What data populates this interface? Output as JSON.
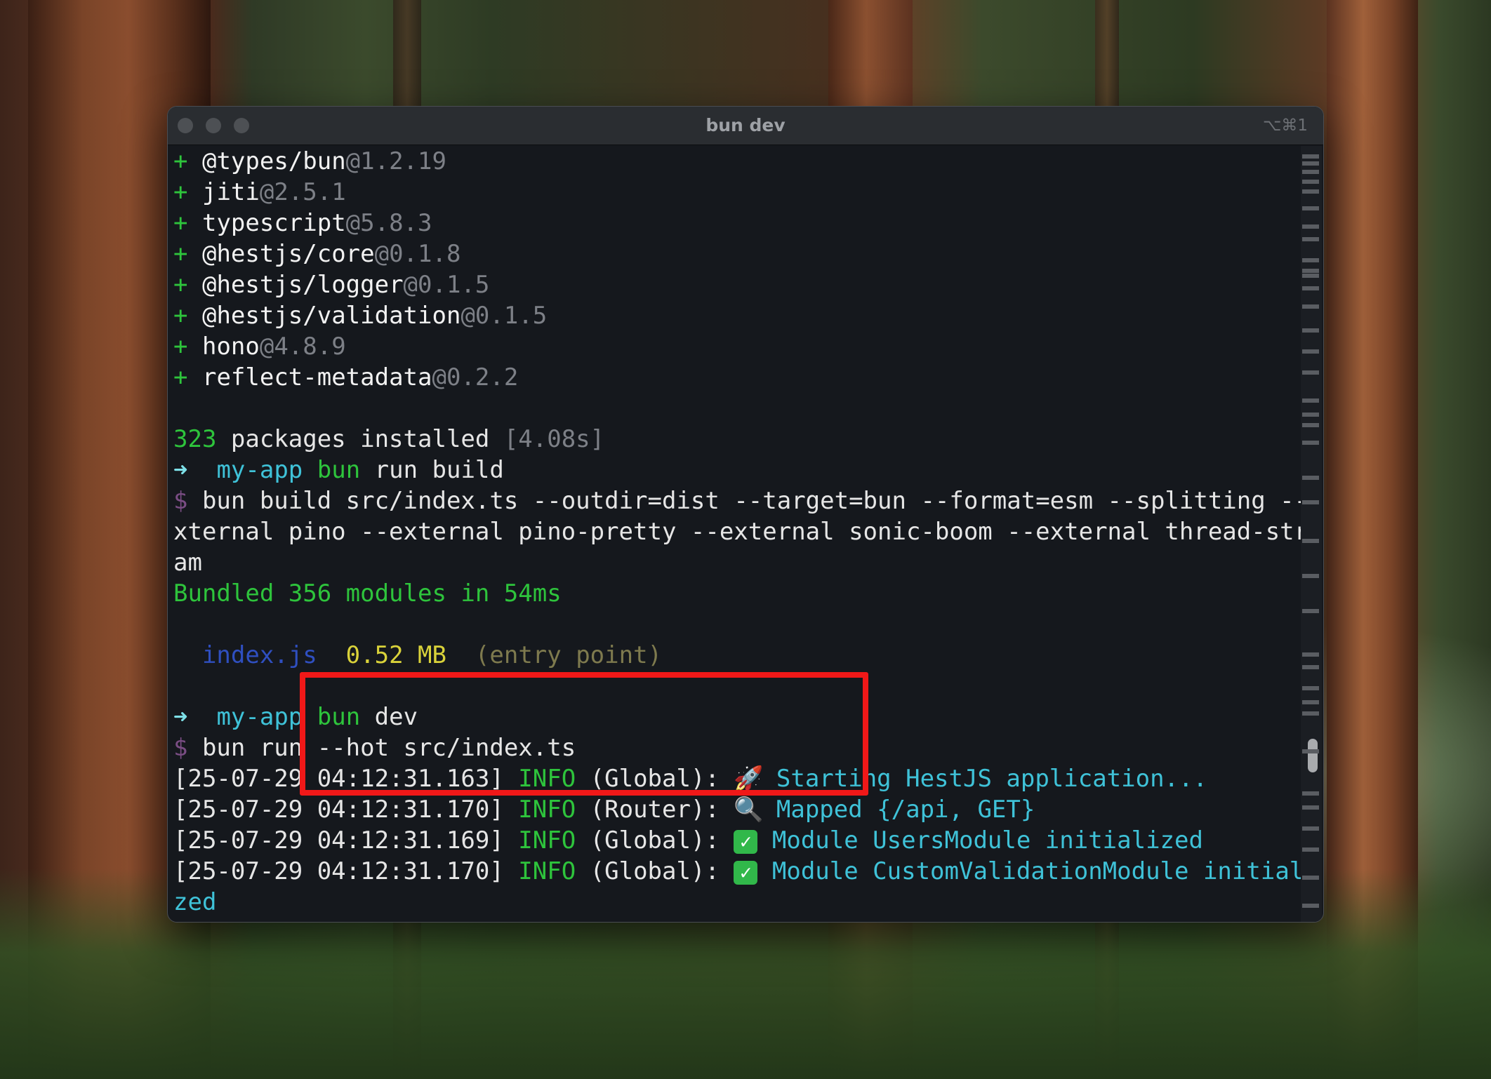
{
  "window": {
    "title": "bun dev",
    "shortcut": "⌥⌘1"
  },
  "install": {
    "packages": [
      {
        "prefix": "+",
        "name": "@types/bun",
        "version": "@1.2.19"
      },
      {
        "prefix": "+",
        "name": "jiti",
        "version": "@2.5.1"
      },
      {
        "prefix": "+",
        "name": "typescript",
        "version": "@5.8.3"
      },
      {
        "prefix": "+",
        "name": "@hestjs/core",
        "version": "@0.1.8"
      },
      {
        "prefix": "+",
        "name": "@hestjs/logger",
        "version": "@0.1.5"
      },
      {
        "prefix": "+",
        "name": "@hestjs/validation",
        "version": "@0.1.5"
      },
      {
        "prefix": "+",
        "name": "hono",
        "version": "@4.8.9"
      },
      {
        "prefix": "+",
        "name": "reflect-metadata",
        "version": "@0.2.2"
      }
    ],
    "count": "323",
    "summary": " packages installed ",
    "time": "[4.08s]"
  },
  "build": {
    "prompt_arrow": "➜",
    "dir": "my-app",
    "cmd_bin": "bun",
    "cmd_rest": " run build",
    "dollar": "$",
    "exec_line1": " bun build src/index.ts --outdir=dist --target=bun --format=esm --splitting --e",
    "exec_line2": "xternal pino --external pino-pretty --external sonic-boom --external thread-stre",
    "exec_line3": "am",
    "bundled": "Bundled 356 modules in 54ms",
    "output_file": "index.js",
    "output_size": "0.52 MB",
    "output_note": "(entry point)"
  },
  "dev": {
    "prompt_arrow": "➜",
    "dir": "my-app",
    "cmd_bin": "bun",
    "cmd_rest": " dev",
    "dollar": "$",
    "exec_line": " bun run --hot src/index.ts",
    "logs": [
      {
        "ts": "[25-07-29 04:12:31.163]",
        "level": "INFO",
        "ctx": "(Global):",
        "icon": "rocket-icon",
        "glyph": "🚀",
        "msg": "Starting HestJS application..."
      },
      {
        "ts": "[25-07-29 04:12:31.170]",
        "level": "INFO",
        "ctx": "(Router):",
        "icon": "magnifier-icon",
        "glyph": "🔍",
        "msg": "Mapped {/api, GET}"
      },
      {
        "ts": "[25-07-29 04:12:31.169]",
        "level": "INFO",
        "ctx": "(Global):",
        "icon": "checkmark-icon",
        "glyph": "✓",
        "msg": "Module UsersModule initialized"
      },
      {
        "ts": "[25-07-29 04:12:31.170]",
        "level": "INFO",
        "ctx": "(Global):",
        "icon": "checkmark-icon",
        "glyph": "✓",
        "msg": "Module CustomValidationModule initiali"
      }
    ],
    "wrap": "zed"
  },
  "colors": {
    "accent_green": "#2ec43c",
    "cyan": "#3fc2d8",
    "highlight_red": "#f01818"
  }
}
